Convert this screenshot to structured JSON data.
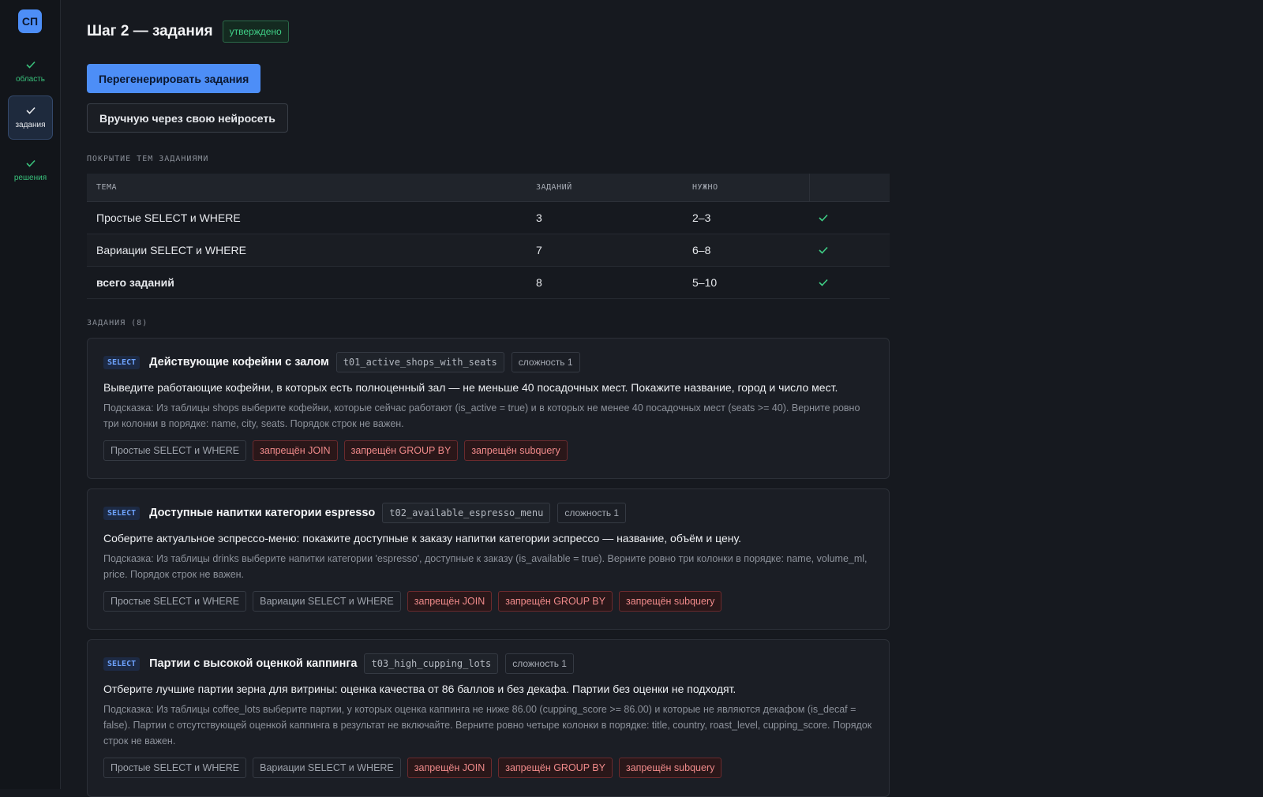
{
  "sidebar": {
    "logo": "СП",
    "steps": [
      {
        "label": "область",
        "done": true
      },
      {
        "label": "задания",
        "done": true,
        "active": true
      },
      {
        "label": "решения",
        "done": true
      }
    ]
  },
  "header": {
    "title": "Шаг 2 — задания",
    "status": "утверждено"
  },
  "actions": {
    "regenerate": "Перегенерировать задания",
    "manual": "Вручную через свою нейросеть"
  },
  "coverage": {
    "label": "ПОКРЫТИЕ ТЕМ ЗАДАНИЯМИ",
    "columns": [
      "ТЕМА",
      "ЗАДАНИЙ",
      "НУЖНО",
      ""
    ],
    "rows": [
      {
        "topic": "Простые SELECT и WHERE",
        "count": "3",
        "need": "2–3",
        "ok": true
      },
      {
        "topic": "Вариации SELECT и WHERE",
        "count": "7",
        "need": "6–8",
        "ok": true
      },
      {
        "topic": "всего заданий",
        "count": "8",
        "need": "5–10",
        "ok": true
      }
    ]
  },
  "tasks_label": "ЗАДАНИЯ (8)",
  "tasks": [
    {
      "kind": "SELECT",
      "title": "Действующие кофейни с залом",
      "code": "t01_active_shops_with_seats",
      "difficulty": "сложность 1",
      "description": "Выведите работающие кофейни, в которых есть полноценный зал — не меньше 40 посадочных мест. Покажите название, город и число мест.",
      "hint": "Подсказка: Из таблицы shops выберите кофейни, которые сейчас работают (is_active = true) и в которых не менее 40 посадочных мест (seats >= 40). Верните ровно три колонки в порядке: name, city, seats. Порядок строк не важен.",
      "topics": [
        "Простые SELECT и WHERE"
      ],
      "bans": [
        "запрещён JOIN",
        "запрещён GROUP BY",
        "запрещён subquery"
      ]
    },
    {
      "kind": "SELECT",
      "title": "Доступные напитки категории espresso",
      "code": "t02_available_espresso_menu",
      "difficulty": "сложность 1",
      "description": "Соберите актуальное эспрессо-меню: покажите доступные к заказу напитки категории эспрессо — название, объём и цену.",
      "hint": "Подсказка: Из таблицы drinks выберите напитки категории 'espresso', доступные к заказу (is_available = true). Верните ровно три колонки в порядке: name, volume_ml, price. Порядок строк не важен.",
      "topics": [
        "Простые SELECT и WHERE",
        "Вариации SELECT и WHERE"
      ],
      "bans": [
        "запрещён JOIN",
        "запрещён GROUP BY",
        "запрещён subquery"
      ]
    },
    {
      "kind": "SELECT",
      "title": "Партии с высокой оценкой каппинга",
      "code": "t03_high_cupping_lots",
      "difficulty": "сложность 1",
      "description": "Отберите лучшие партии зерна для витрины: оценка качества от 86 баллов и без декафа. Партии без оценки не подходят.",
      "hint": "Подсказка: Из таблицы coffee_lots выберите партии, у которых оценка каппинга не ниже 86.00 (cupping_score >= 86.00) и которые не являются декафом (is_decaf = false). Партии с отсутствующей оценкой каппинга в результат не включайте. Верните ровно четыре колонки в порядке: title, country, roast_level, cupping_score. Порядок строк не важен.",
      "topics": [
        "Простые SELECT и WHERE",
        "Вариации SELECT и WHERE"
      ],
      "bans": [
        "запрещён JOIN",
        "запрещён GROUP BY",
        "запрещён subquery"
      ]
    }
  ],
  "colors": {
    "accent": "#4d8ef7",
    "ok": "#3fcf86",
    "ban": "#f08a8a",
    "background": "#16191f"
  }
}
